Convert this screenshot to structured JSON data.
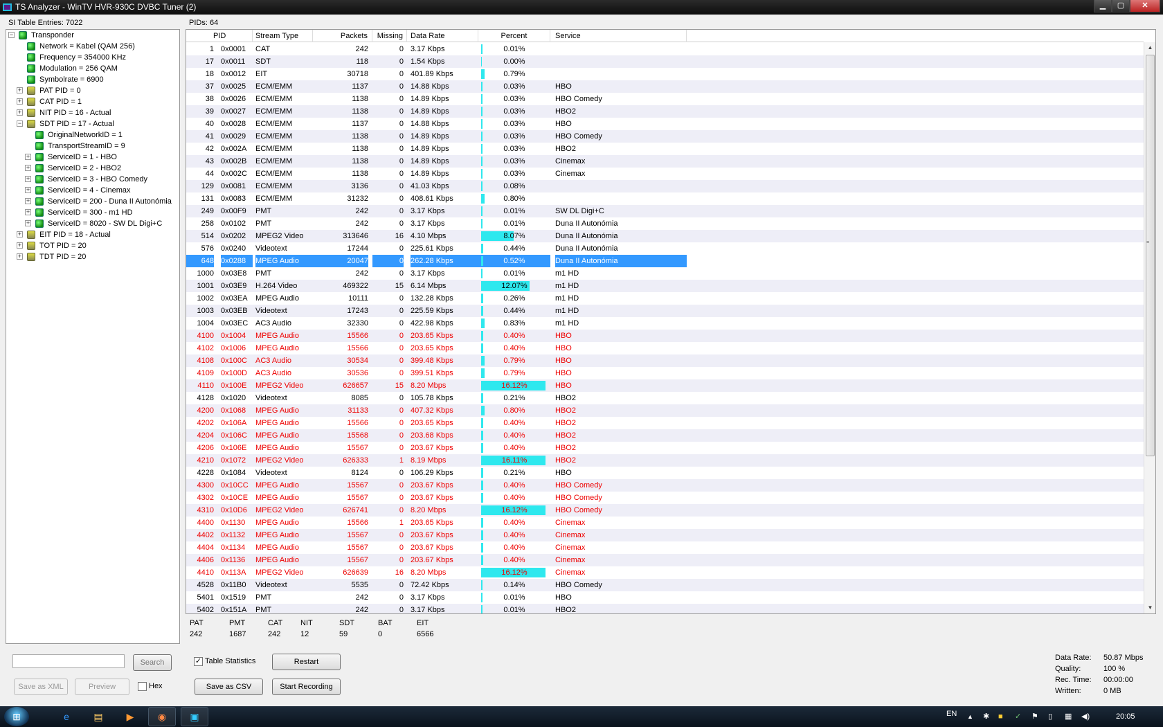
{
  "window": {
    "title": "TS Analyzer - WinTV HVR-930C DVBC Tuner (2)",
    "minimize": "▁",
    "maximize": "▢",
    "close": "✕"
  },
  "si_entries": "SI Table Entries: 7022",
  "pids_count": "PIDs: 64",
  "tree": [
    {
      "label": "Transponder",
      "icon": "green",
      "indent": 0,
      "expander": "−"
    },
    {
      "label": "Network = Kabel (QAM 256)",
      "icon": "green",
      "indent": 1,
      "expander": ""
    },
    {
      "label": "Frequency = 354000 KHz",
      "icon": "green",
      "indent": 1,
      "expander": ""
    },
    {
      "label": "Modulation = 256 QAM",
      "icon": "green",
      "indent": 1,
      "expander": ""
    },
    {
      "label": "Symbolrate = 6900",
      "icon": "green",
      "indent": 1,
      "expander": ""
    },
    {
      "label": "PAT PID = 0",
      "icon": "table",
      "indent": 1,
      "expander": "+"
    },
    {
      "label": "CAT PID = 1",
      "icon": "table",
      "indent": 1,
      "expander": "+"
    },
    {
      "label": "NIT PID = 16 - Actual",
      "icon": "table",
      "indent": 1,
      "expander": "+"
    },
    {
      "label": "SDT PID = 17 - Actual",
      "icon": "table",
      "indent": 1,
      "expander": "−"
    },
    {
      "label": "OriginalNetworkID = 1",
      "icon": "green",
      "indent": 2,
      "expander": ""
    },
    {
      "label": "TransportStreamID = 9",
      "icon": "green",
      "indent": 2,
      "expander": ""
    },
    {
      "label": "ServiceID = 1 - HBO",
      "icon": "green",
      "indent": 2,
      "expander": "+"
    },
    {
      "label": "ServiceID = 2 - HBO2",
      "icon": "green",
      "indent": 2,
      "expander": "+"
    },
    {
      "label": "ServiceID = 3 - HBO Comedy",
      "icon": "green",
      "indent": 2,
      "expander": "+"
    },
    {
      "label": "ServiceID = 4 - Cinemax",
      "icon": "green",
      "indent": 2,
      "expander": "+"
    },
    {
      "label": "ServiceID = 200 - Duna II Autonómia",
      "icon": "green",
      "indent": 2,
      "expander": "+"
    },
    {
      "label": "ServiceID = 300 - m1 HD",
      "icon": "green",
      "indent": 2,
      "expander": "+"
    },
    {
      "label": "ServiceID = 8020 - SW DL Digi+C",
      "icon": "green",
      "indent": 2,
      "expander": "+"
    },
    {
      "label": "EIT PID = 18 - Actual",
      "icon": "table",
      "indent": 1,
      "expander": "+"
    },
    {
      "label": "TOT PID = 20",
      "icon": "table",
      "indent": 1,
      "expander": "+"
    },
    {
      "label": "TDT PID = 20",
      "icon": "table",
      "indent": 1,
      "expander": "+"
    }
  ],
  "columns": [
    "PID",
    "Stream Type",
    "Packets",
    "Missing",
    "Data Rate",
    "Percent",
    "Service"
  ],
  "rows": [
    {
      "pid": "1",
      "hex": "0x0001",
      "type": "CAT",
      "packets": "242",
      "missing": "0",
      "rate": "3.17 Kbps",
      "pct": "0.01%",
      "pv": 0.01,
      "service": "",
      "red": false
    },
    {
      "pid": "17",
      "hex": "0x0011",
      "type": "SDT",
      "packets": "118",
      "missing": "0",
      "rate": "1.54 Kbps",
      "pct": "0.00%",
      "pv": 0.0,
      "service": "",
      "red": false
    },
    {
      "pid": "18",
      "hex": "0x0012",
      "type": "EIT",
      "packets": "30718",
      "missing": "0",
      "rate": "401.89 Kbps",
      "pct": "0.79%",
      "pv": 0.79,
      "service": "",
      "red": false
    },
    {
      "pid": "37",
      "hex": "0x0025",
      "type": "ECM/EMM",
      "packets": "1137",
      "missing": "0",
      "rate": "14.88 Kbps",
      "pct": "0.03%",
      "pv": 0.03,
      "service": "HBO",
      "red": false
    },
    {
      "pid": "38",
      "hex": "0x0026",
      "type": "ECM/EMM",
      "packets": "1138",
      "missing": "0",
      "rate": "14.89 Kbps",
      "pct": "0.03%",
      "pv": 0.03,
      "service": "HBO Comedy",
      "red": false
    },
    {
      "pid": "39",
      "hex": "0x0027",
      "type": "ECM/EMM",
      "packets": "1138",
      "missing": "0",
      "rate": "14.89 Kbps",
      "pct": "0.03%",
      "pv": 0.03,
      "service": "HBO2",
      "red": false
    },
    {
      "pid": "40",
      "hex": "0x0028",
      "type": "ECM/EMM",
      "packets": "1137",
      "missing": "0",
      "rate": "14.88 Kbps",
      "pct": "0.03%",
      "pv": 0.03,
      "service": "HBO",
      "red": false
    },
    {
      "pid": "41",
      "hex": "0x0029",
      "type": "ECM/EMM",
      "packets": "1138",
      "missing": "0",
      "rate": "14.89 Kbps",
      "pct": "0.03%",
      "pv": 0.03,
      "service": "HBO Comedy",
      "red": false
    },
    {
      "pid": "42",
      "hex": "0x002A",
      "type": "ECM/EMM",
      "packets": "1138",
      "missing": "0",
      "rate": "14.89 Kbps",
      "pct": "0.03%",
      "pv": 0.03,
      "service": "HBO2",
      "red": false
    },
    {
      "pid": "43",
      "hex": "0x002B",
      "type": "ECM/EMM",
      "packets": "1138",
      "missing": "0",
      "rate": "14.89 Kbps",
      "pct": "0.03%",
      "pv": 0.03,
      "service": "Cinemax",
      "red": false
    },
    {
      "pid": "44",
      "hex": "0x002C",
      "type": "ECM/EMM",
      "packets": "1138",
      "missing": "0",
      "rate": "14.89 Kbps",
      "pct": "0.03%",
      "pv": 0.03,
      "service": "Cinemax",
      "red": false
    },
    {
      "pid": "129",
      "hex": "0x0081",
      "type": "ECM/EMM",
      "packets": "3136",
      "missing": "0",
      "rate": "41.03 Kbps",
      "pct": "0.08%",
      "pv": 0.08,
      "service": "",
      "red": false
    },
    {
      "pid": "131",
      "hex": "0x0083",
      "type": "ECM/EMM",
      "packets": "31232",
      "missing": "0",
      "rate": "408.61 Kbps",
      "pct": "0.80%",
      "pv": 0.8,
      "service": "",
      "red": false
    },
    {
      "pid": "249",
      "hex": "0x00F9",
      "type": "PMT",
      "packets": "242",
      "missing": "0",
      "rate": "3.17 Kbps",
      "pct": "0.01%",
      "pv": 0.01,
      "service": "SW DL Digi+C",
      "red": false
    },
    {
      "pid": "258",
      "hex": "0x0102",
      "type": "PMT",
      "packets": "242",
      "missing": "0",
      "rate": "3.17 Kbps",
      "pct": "0.01%",
      "pv": 0.01,
      "service": "Duna II Autonómia",
      "red": false
    },
    {
      "pid": "514",
      "hex": "0x0202",
      "type": "MPEG2 Video",
      "packets": "313646",
      "missing": "16",
      "rate": "4.10 Mbps",
      "pct": "8.07%",
      "pv": 8.07,
      "service": "Duna II Autonómia",
      "red": false
    },
    {
      "pid": "576",
      "hex": "0x0240",
      "type": "Videotext",
      "packets": "17244",
      "missing": "0",
      "rate": "225.61 Kbps",
      "pct": "0.44%",
      "pv": 0.44,
      "service": "Duna II Autonómia",
      "red": false
    },
    {
      "pid": "648",
      "hex": "0x0288",
      "type": "MPEG Audio",
      "packets": "20047",
      "missing": "0",
      "rate": "262.28 Kbps",
      "pct": "0.52%",
      "pv": 0.52,
      "service": "Duna II Autonómia",
      "red": false,
      "selected": true
    },
    {
      "pid": "1000",
      "hex": "0x03E8",
      "type": "PMT",
      "packets": "242",
      "missing": "0",
      "rate": "3.17 Kbps",
      "pct": "0.01%",
      "pv": 0.01,
      "service": "m1 HD",
      "red": false
    },
    {
      "pid": "1001",
      "hex": "0x03E9",
      "type": "H.264 Video",
      "packets": "469322",
      "missing": "15",
      "rate": "6.14 Mbps",
      "pct": "12.07%",
      "pv": 12.07,
      "service": "m1 HD",
      "red": false
    },
    {
      "pid": "1002",
      "hex": "0x03EA",
      "type": "MPEG Audio",
      "packets": "10111",
      "missing": "0",
      "rate": "132.28 Kbps",
      "pct": "0.26%",
      "pv": 0.26,
      "service": "m1 HD",
      "red": false
    },
    {
      "pid": "1003",
      "hex": "0x03EB",
      "type": "Videotext",
      "packets": "17243",
      "missing": "0",
      "rate": "225.59 Kbps",
      "pct": "0.44%",
      "pv": 0.44,
      "service": "m1 HD",
      "red": false
    },
    {
      "pid": "1004",
      "hex": "0x03EC",
      "type": "AC3 Audio",
      "packets": "32330",
      "missing": "0",
      "rate": "422.98 Kbps",
      "pct": "0.83%",
      "pv": 0.83,
      "service": "m1 HD",
      "red": false
    },
    {
      "pid": "4100",
      "hex": "0x1004",
      "type": "MPEG Audio",
      "packets": "15566",
      "missing": "0",
      "rate": "203.65 Kbps",
      "pct": "0.40%",
      "pv": 0.4,
      "service": "HBO",
      "red": true
    },
    {
      "pid": "4102",
      "hex": "0x1006",
      "type": "MPEG Audio",
      "packets": "15566",
      "missing": "0",
      "rate": "203.65 Kbps",
      "pct": "0.40%",
      "pv": 0.4,
      "service": "HBO",
      "red": true
    },
    {
      "pid": "4108",
      "hex": "0x100C",
      "type": "AC3 Audio",
      "packets": "30534",
      "missing": "0",
      "rate": "399.48 Kbps",
      "pct": "0.79%",
      "pv": 0.79,
      "service": "HBO",
      "red": true
    },
    {
      "pid": "4109",
      "hex": "0x100D",
      "type": "AC3 Audio",
      "packets": "30536",
      "missing": "0",
      "rate": "399.51 Kbps",
      "pct": "0.79%",
      "pv": 0.79,
      "service": "HBO",
      "red": true
    },
    {
      "pid": "4110",
      "hex": "0x100E",
      "type": "MPEG2 Video",
      "packets": "626657",
      "missing": "15",
      "rate": "8.20 Mbps",
      "pct": "16.12%",
      "pv": 16.12,
      "service": "HBO",
      "red": true
    },
    {
      "pid": "4128",
      "hex": "0x1020",
      "type": "Videotext",
      "packets": "8085",
      "missing": "0",
      "rate": "105.78 Kbps",
      "pct": "0.21%",
      "pv": 0.21,
      "service": "HBO2",
      "red": false
    },
    {
      "pid": "4200",
      "hex": "0x1068",
      "type": "MPEG Audio",
      "packets": "31133",
      "missing": "0",
      "rate": "407.32 Kbps",
      "pct": "0.80%",
      "pv": 0.8,
      "service": "HBO2",
      "red": true
    },
    {
      "pid": "4202",
      "hex": "0x106A",
      "type": "MPEG Audio",
      "packets": "15566",
      "missing": "0",
      "rate": "203.65 Kbps",
      "pct": "0.40%",
      "pv": 0.4,
      "service": "HBO2",
      "red": true
    },
    {
      "pid": "4204",
      "hex": "0x106C",
      "type": "MPEG Audio",
      "packets": "15568",
      "missing": "0",
      "rate": "203.68 Kbps",
      "pct": "0.40%",
      "pv": 0.4,
      "service": "HBO2",
      "red": true
    },
    {
      "pid": "4206",
      "hex": "0x106E",
      "type": "MPEG Audio",
      "packets": "15567",
      "missing": "0",
      "rate": "203.67 Kbps",
      "pct": "0.40%",
      "pv": 0.4,
      "service": "HBO2",
      "red": true
    },
    {
      "pid": "4210",
      "hex": "0x1072",
      "type": "MPEG2 Video",
      "packets": "626333",
      "missing": "1",
      "rate": "8.19 Mbps",
      "pct": "16.11%",
      "pv": 16.11,
      "service": "HBO2",
      "red": true
    },
    {
      "pid": "4228",
      "hex": "0x1084",
      "type": "Videotext",
      "packets": "8124",
      "missing": "0",
      "rate": "106.29 Kbps",
      "pct": "0.21%",
      "pv": 0.21,
      "service": "HBO",
      "red": false
    },
    {
      "pid": "4300",
      "hex": "0x10CC",
      "type": "MPEG Audio",
      "packets": "15567",
      "missing": "0",
      "rate": "203.67 Kbps",
      "pct": "0.40%",
      "pv": 0.4,
      "service": "HBO Comedy",
      "red": true
    },
    {
      "pid": "4302",
      "hex": "0x10CE",
      "type": "MPEG Audio",
      "packets": "15567",
      "missing": "0",
      "rate": "203.67 Kbps",
      "pct": "0.40%",
      "pv": 0.4,
      "service": "HBO Comedy",
      "red": true
    },
    {
      "pid": "4310",
      "hex": "0x10D6",
      "type": "MPEG2 Video",
      "packets": "626741",
      "missing": "0",
      "rate": "8.20 Mbps",
      "pct": "16.12%",
      "pv": 16.12,
      "service": "HBO Comedy",
      "red": true
    },
    {
      "pid": "4400",
      "hex": "0x1130",
      "type": "MPEG Audio",
      "packets": "15566",
      "missing": "1",
      "rate": "203.65 Kbps",
      "pct": "0.40%",
      "pv": 0.4,
      "service": "Cinemax",
      "red": true
    },
    {
      "pid": "4402",
      "hex": "0x1132",
      "type": "MPEG Audio",
      "packets": "15567",
      "missing": "0",
      "rate": "203.67 Kbps",
      "pct": "0.40%",
      "pv": 0.4,
      "service": "Cinemax",
      "red": true
    },
    {
      "pid": "4404",
      "hex": "0x1134",
      "type": "MPEG Audio",
      "packets": "15567",
      "missing": "0",
      "rate": "203.67 Kbps",
      "pct": "0.40%",
      "pv": 0.4,
      "service": "Cinemax",
      "red": true
    },
    {
      "pid": "4406",
      "hex": "0x1136",
      "type": "MPEG Audio",
      "packets": "15567",
      "missing": "0",
      "rate": "203.67 Kbps",
      "pct": "0.40%",
      "pv": 0.4,
      "service": "Cinemax",
      "red": true
    },
    {
      "pid": "4410",
      "hex": "0x113A",
      "type": "MPEG2 Video",
      "packets": "626639",
      "missing": "16",
      "rate": "8.20 Mbps",
      "pct": "16.12%",
      "pv": 16.12,
      "service": "Cinemax",
      "red": true
    },
    {
      "pid": "4528",
      "hex": "0x11B0",
      "type": "Videotext",
      "packets": "5535",
      "missing": "0",
      "rate": "72.42 Kbps",
      "pct": "0.14%",
      "pv": 0.14,
      "service": "HBO Comedy",
      "red": false
    },
    {
      "pid": "5401",
      "hex": "0x1519",
      "type": "PMT",
      "packets": "242",
      "missing": "0",
      "rate": "3.17 Kbps",
      "pct": "0.01%",
      "pv": 0.01,
      "service": "HBO",
      "red": false
    },
    {
      "pid": "5402",
      "hex": "0x151A",
      "type": "PMT",
      "packets": "242",
      "missing": "0",
      "rate": "3.17 Kbps",
      "pct": "0.01%",
      "pv": 0.01,
      "service": "HBO2",
      "red": false
    }
  ],
  "table_stats": [
    {
      "name": "PAT",
      "value": "242"
    },
    {
      "name": "PMT",
      "value": "1687"
    },
    {
      "name": "CAT",
      "value": "242"
    },
    {
      "name": "NIT",
      "value": "12"
    },
    {
      "name": "SDT",
      "value": "59"
    },
    {
      "name": "BAT",
      "value": "0"
    },
    {
      "name": "EIT",
      "value": "6566"
    }
  ],
  "left_panel": {
    "search_value": "",
    "search": "Search",
    "save_xml": "Save as XML",
    "preview": "Preview",
    "hex": "Hex"
  },
  "controls": {
    "table_statistics": "Table Statistics",
    "table_statistics_checked": true,
    "restart": "Restart",
    "save_csv": "Save as CSV",
    "start_recording": "Start Recording"
  },
  "status": {
    "data_rate_label": "Data Rate:",
    "data_rate": "50.87 Mbps",
    "quality_label": "Quality:",
    "quality": "100 %",
    "rec_time_label": "Rec. Time:",
    "rec_time": "00:00:00",
    "written_label": "Written:",
    "written": "0 MB"
  },
  "taskbar": {
    "lang": "EN",
    "clock": "20:05",
    "start_icon": "windows-orb",
    "apps": [
      "ie-icon",
      "explorer-icon",
      "media-player-icon",
      "firefox-icon",
      "ts-analyzer-icon"
    ]
  },
  "colors": {
    "bar": "#2ee8ee",
    "selection": "#3399ff",
    "error_text": "#e00000"
  }
}
